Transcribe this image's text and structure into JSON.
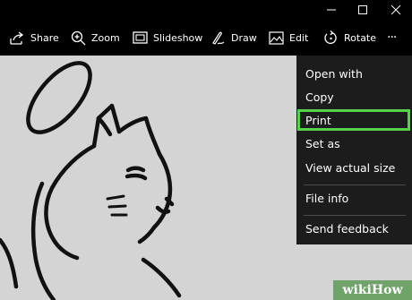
{
  "window_controls": {
    "minimize_icon": "minimize-icon",
    "maximize_icon": "maximize-icon",
    "close_icon": "close-icon"
  },
  "toolbar": {
    "items": [
      {
        "label": "Share",
        "icon": "share-icon"
      },
      {
        "label": "Zoom",
        "icon": "zoom-icon"
      },
      {
        "label": "Slideshow",
        "icon": "slideshow-icon"
      },
      {
        "label": "Draw",
        "icon": "draw-pen-icon"
      },
      {
        "label": "Edit",
        "icon": "edit-image-icon"
      },
      {
        "label": "Rotate",
        "icon": "rotate-icon"
      }
    ],
    "more_label": "···"
  },
  "context_menu": {
    "items": [
      {
        "label": "Open with"
      },
      {
        "label": "Copy"
      },
      {
        "label": "Print"
      },
      {
        "label": "Set as"
      },
      {
        "label": "View actual size"
      },
      {
        "label": "File info"
      },
      {
        "label": "Send feedback"
      }
    ],
    "highlighted": "Print",
    "highlight_color": "#55d14a"
  },
  "image": {
    "subject": "cat-sketch-image"
  },
  "watermark": {
    "text": "wikiHow"
  },
  "colors": {
    "toolbar_bg": "#000000",
    "menu_bg": "#1c1c1c",
    "canvas_bg": "#d4d4d4",
    "highlight": "#55d14a"
  }
}
